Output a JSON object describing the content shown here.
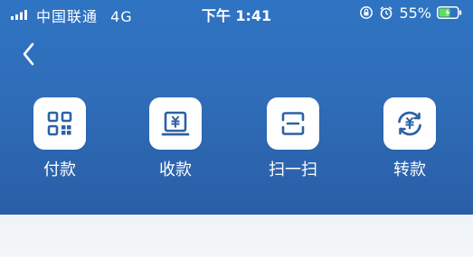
{
  "status_bar": {
    "carrier": "中国联通",
    "network": "4G",
    "time": "下午 1:41",
    "battery": "55%"
  },
  "header": {
    "back_icon": "chevron-left-icon"
  },
  "actions": [
    {
      "label": "付款",
      "icon": "qr-code-icon"
    },
    {
      "label": "收款",
      "icon": "receive-money-icon"
    },
    {
      "label": "扫一扫",
      "icon": "scan-icon"
    },
    {
      "label": "转款",
      "icon": "transfer-icon"
    }
  ],
  "colors": {
    "header_bg": "#2f6db8",
    "icon_blue": "#2e61a4",
    "tile_bg": "#ffffff"
  }
}
